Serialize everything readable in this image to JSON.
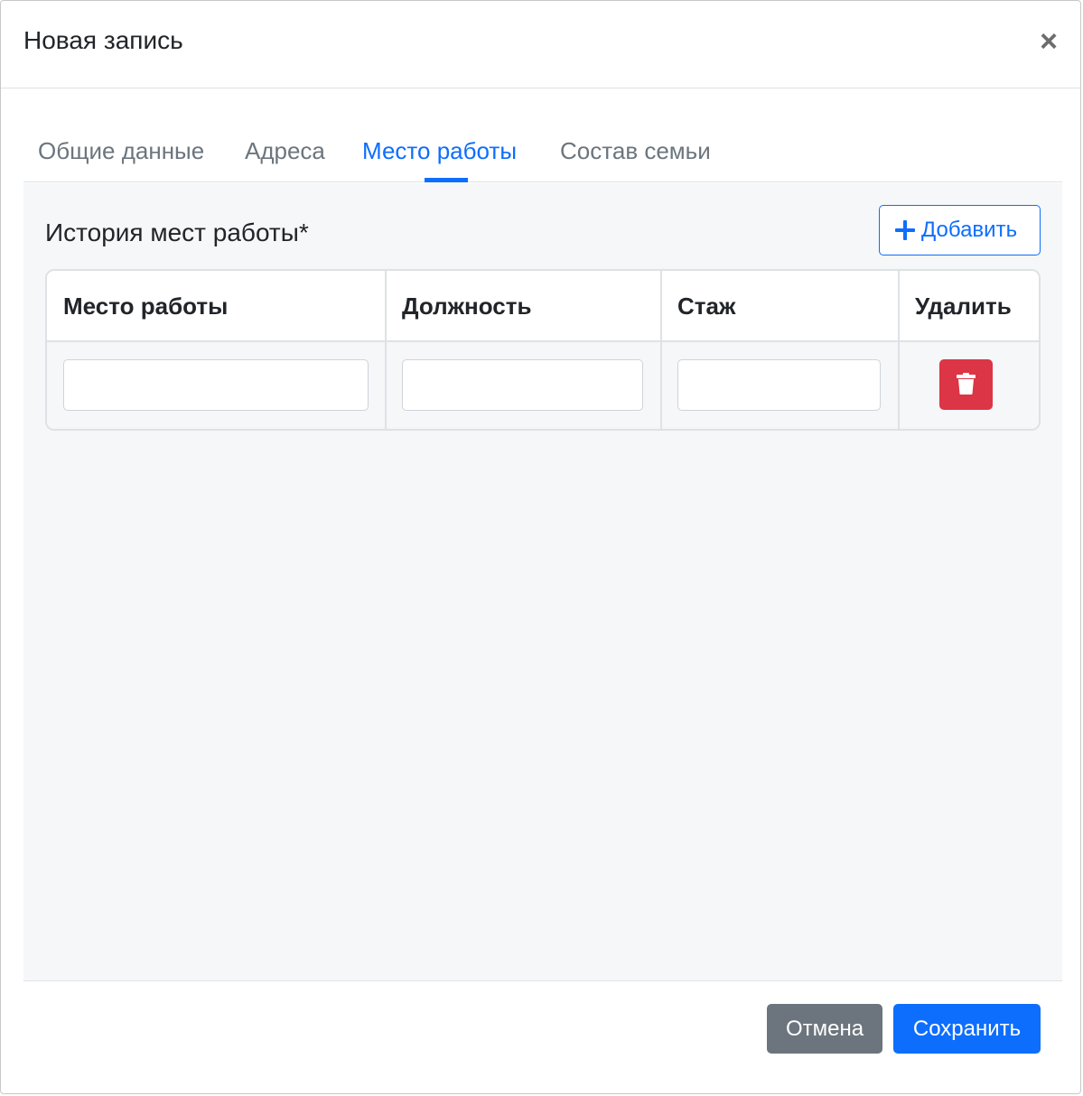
{
  "header": {
    "title": "Новая запись",
    "close_symbol": "×"
  },
  "tabs": [
    {
      "label": "Общие данные",
      "active": false
    },
    {
      "label": "Адреса",
      "active": false
    },
    {
      "label": "Место работы",
      "active": true
    },
    {
      "label": "Состав семьи",
      "active": false
    }
  ],
  "section": {
    "title": "История мест работы*",
    "add_button_label": "Добавить",
    "add_button_icon": "plus-icon"
  },
  "table": {
    "columns": [
      "Место работы",
      "Должность",
      "Стаж",
      "Удалить"
    ],
    "rows": [
      {
        "workplace": "",
        "position": "",
        "experience": "",
        "delete_icon": "trash-icon"
      }
    ]
  },
  "footer": {
    "cancel_label": "Отмена",
    "save_label": "Сохранить"
  },
  "colors": {
    "primary": "#0d6efd",
    "secondary": "#6c757d",
    "danger": "#dc3545",
    "tab_panel_background": "#f6f7f9"
  }
}
